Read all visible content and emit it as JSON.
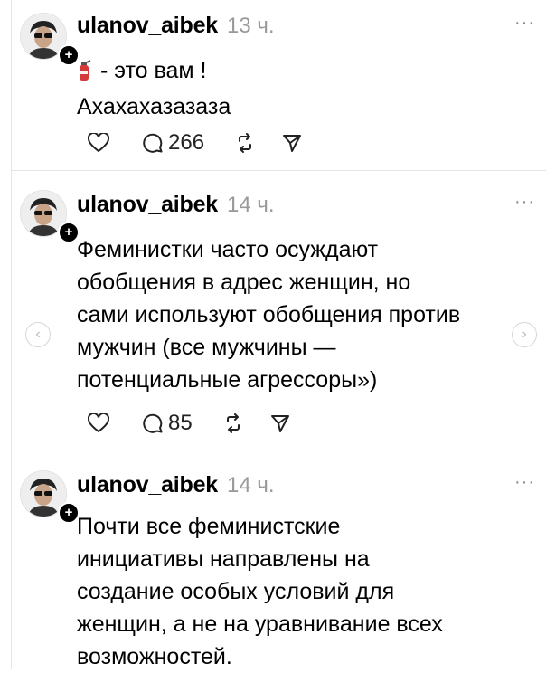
{
  "posts": [
    {
      "username": "ulanov_aibek",
      "time": "13 ч.",
      "more": "···",
      "emoji": "fire-extinguisher-icon",
      "lines": [
        "- это вам !",
        "Ахахахазазаза"
      ],
      "replies": "266"
    },
    {
      "username": "ulanov_aibek",
      "time": "14 ч.",
      "more": "···",
      "lines": [
        "Феминистки часто осуждают",
        "обобщения в адрес женщин, но",
        "сами используют обобщения против",
        "мужчин (все мужчины —",
        "потенциальные агрессоры»)"
      ],
      "replies": "85"
    },
    {
      "username": "ulanov_aibek",
      "time": "14 ч.",
      "more": "···",
      "lines": [
        "Почти все феминистские",
        "инициативы направлены на",
        "создание особых условий для",
        "женщин, а не на уравнивание всех",
        "возможностей."
      ]
    }
  ],
  "nav": {
    "prev": "‹",
    "next": "›"
  },
  "colors": {
    "text": "#000000",
    "muted": "#999999",
    "divider": "#e4e4e4"
  }
}
